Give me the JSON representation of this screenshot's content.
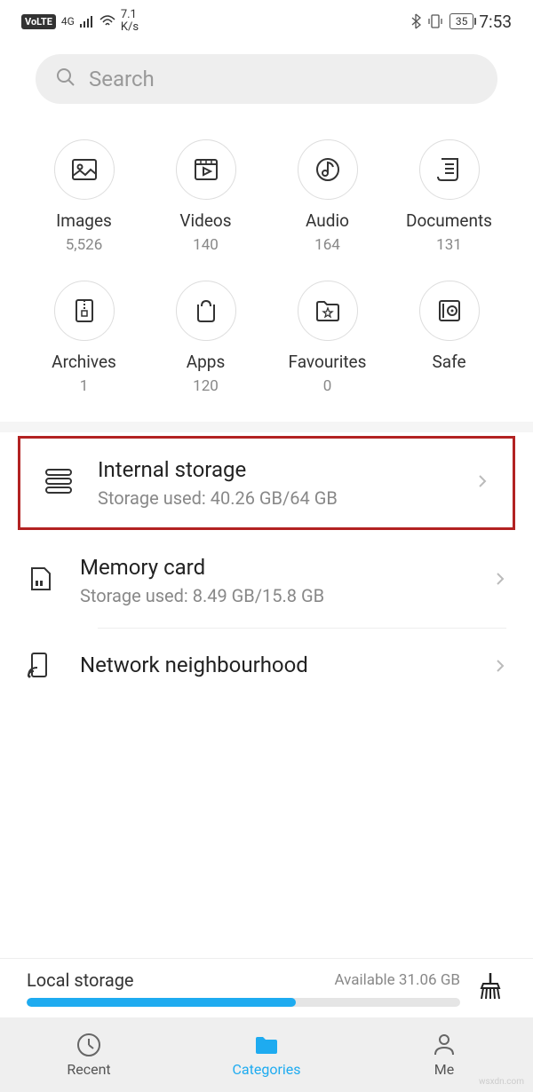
{
  "status": {
    "volte": "VoLTE",
    "network": "4G",
    "speed_top": "7.1",
    "speed_bottom": "K/s",
    "battery": "35",
    "time": "7:53"
  },
  "search": {
    "placeholder": "Search"
  },
  "categories": [
    {
      "label": "Images",
      "count": "5,526"
    },
    {
      "label": "Videos",
      "count": "140"
    },
    {
      "label": "Audio",
      "count": "164"
    },
    {
      "label": "Documents",
      "count": "131"
    },
    {
      "label": "Archives",
      "count": "1"
    },
    {
      "label": "Apps",
      "count": "120"
    },
    {
      "label": "Favourites",
      "count": "0"
    },
    {
      "label": "Safe",
      "count": ""
    }
  ],
  "storage": {
    "internal": {
      "title": "Internal storage",
      "sub": "Storage used: 40.26 GB/64 GB"
    },
    "memory": {
      "title": "Memory card",
      "sub": "Storage used: 8.49 GB/15.8 GB"
    },
    "network": {
      "title": "Network neighbourhood",
      "sub": ""
    }
  },
  "local": {
    "title": "Local storage",
    "available": "Available 31.06 GB"
  },
  "nav": {
    "recent": "Recent",
    "categories": "Categories",
    "me": "Me"
  },
  "watermark": "wsxdn.com"
}
